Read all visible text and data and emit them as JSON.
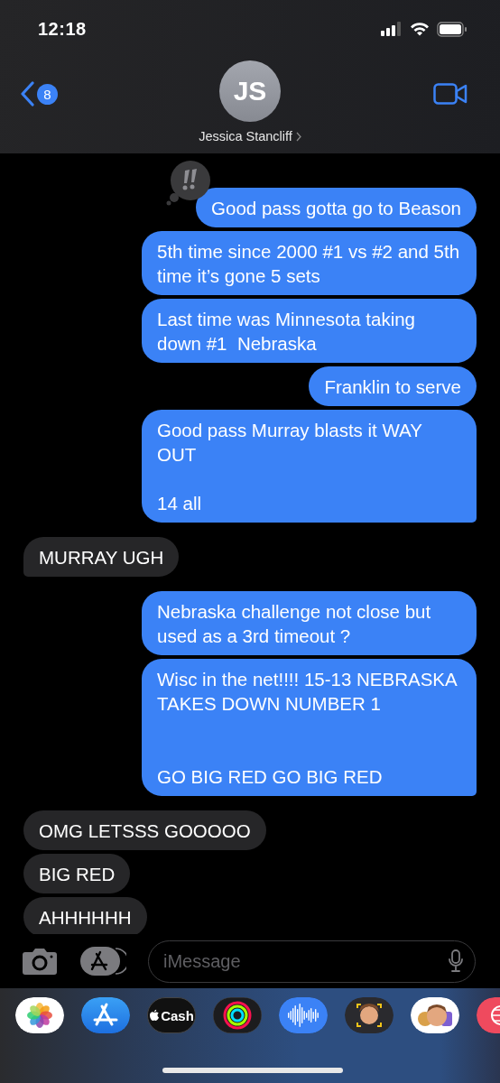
{
  "status_bar": {
    "time": "12:18"
  },
  "header": {
    "back_badge": "8",
    "avatar_initials": "JS",
    "contact_name": "Jessica Stancliff"
  },
  "messages": [
    {
      "kind": "sent",
      "text": "Good pass gotta go to Beason",
      "tail": false,
      "tapback": true
    },
    {
      "kind": "sent",
      "text": "5th time since 2000 #1 vs #2 and 5th time it’s gone 5 sets",
      "tail": false
    },
    {
      "kind": "sent",
      "text": "Last time was Minnesota taking down #1  Nebraska",
      "tail": false
    },
    {
      "kind": "sent",
      "text": "Franklin to serve",
      "tail": false
    },
    {
      "kind": "sent",
      "text": "Good pass Murray blasts it WAY OUT\n\n14 all",
      "tail": true
    },
    {
      "kind": "received",
      "text": "MURRAY UGH",
      "tail": true
    },
    {
      "kind": "sent",
      "text": "Nebraska challenge not close but used as a 3rd timeout ?",
      "tail": false
    },
    {
      "kind": "sent",
      "text": "Wisc in the net!!!! 15-13 NEBRASKA TAKES DOWN NUMBER 1\n\n\nGO BIG RED GO BIG RED",
      "tail": true
    },
    {
      "kind": "received",
      "text": "OMG LETSSS GOOOOO",
      "tail": false
    },
    {
      "kind": "received",
      "text": "BIG RED",
      "tail": false
    },
    {
      "kind": "received",
      "text": "AHHHHHH",
      "tail": false
    }
  ],
  "composer": {
    "placeholder": "iMessage"
  },
  "app_tray": [
    {
      "kind": "photos"
    },
    {
      "kind": "store"
    },
    {
      "kind": "cash",
      "label": "Cash"
    },
    {
      "kind": "rings"
    },
    {
      "kind": "audio"
    },
    {
      "kind": "avatar"
    },
    {
      "kind": "stickers"
    },
    {
      "kind": "globe"
    }
  ]
}
